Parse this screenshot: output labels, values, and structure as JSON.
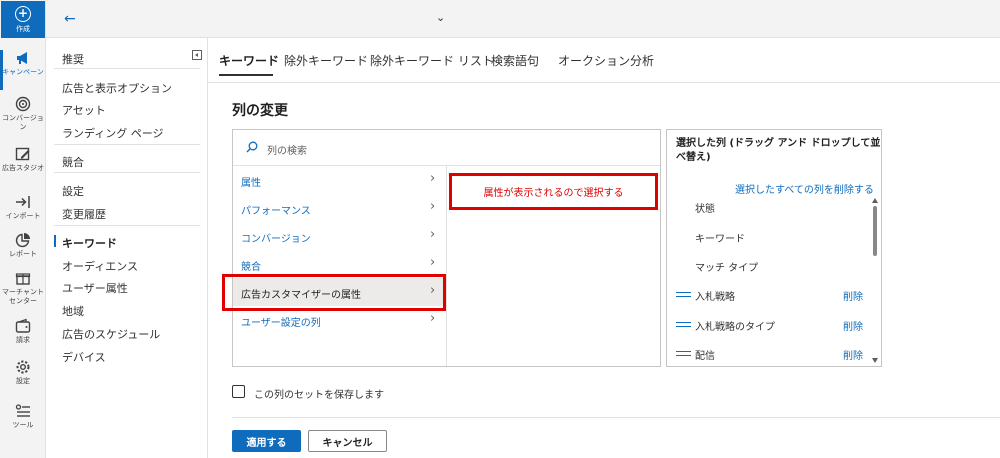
{
  "rail": {
    "create_label": "作成",
    "items": [
      {
        "label": "キャンペーン",
        "icon": "megaphone-icon"
      },
      {
        "label": "コンバージョン",
        "icon": "target-icon"
      },
      {
        "label": "広告スタジオ",
        "icon": "pencil-canvas-icon"
      },
      {
        "label": "インポート",
        "icon": "import-arrow-icon"
      },
      {
        "label": "レポート",
        "icon": "pie-chart-icon"
      },
      {
        "label": "マーチャント センター",
        "icon": "gift-box-icon"
      },
      {
        "label": "請求",
        "icon": "wallet-icon"
      },
      {
        "label": "設定",
        "icon": "gear-icon"
      },
      {
        "label": "ツール",
        "icon": "tools-list-icon"
      }
    ]
  },
  "sidenav": {
    "items": [
      "推奨",
      "広告と表示オプション",
      "アセット",
      "ランディング ページ",
      "競合",
      "設定",
      "変更履歴",
      "キーワード",
      "オーディエンス",
      "ユーザー属性",
      "地域",
      "広告のスケジュール",
      "デバイス"
    ],
    "active": "キーワード"
  },
  "tabs": [
    "キーワード",
    "除外キーワード",
    "除外キーワード リスト",
    "検索語句",
    "オークション分析"
  ],
  "main": {
    "title": "列の変更",
    "search_placeholder": "列の検索",
    "categories": [
      "属性",
      "パフォーマンス",
      "コンバージョン",
      "競合",
      "広告カスタマイザーの属性",
      "ユーザー設定の列"
    ],
    "selected_category": "広告カスタマイザーの属性",
    "annotation": "属性が表示されるので選択する",
    "selected_panel": {
      "title": "選択した列 (ドラッグ アンド ドロップして並べ替え)",
      "remove_all": "選択したすべての列を削除する",
      "fixed_items": [
        "状態",
        "キーワード",
        "マッチ タイプ"
      ],
      "movable_items": [
        "入札戦略",
        "入札戦略のタイプ",
        "配信"
      ],
      "delete_label": "削除"
    },
    "save_set_label": "この列のセットを保存します",
    "apply_label": "適用する",
    "cancel_label": "キャンセル"
  },
  "colors": {
    "accent": "#0f6cbd",
    "annotation_red": "#e00000"
  }
}
